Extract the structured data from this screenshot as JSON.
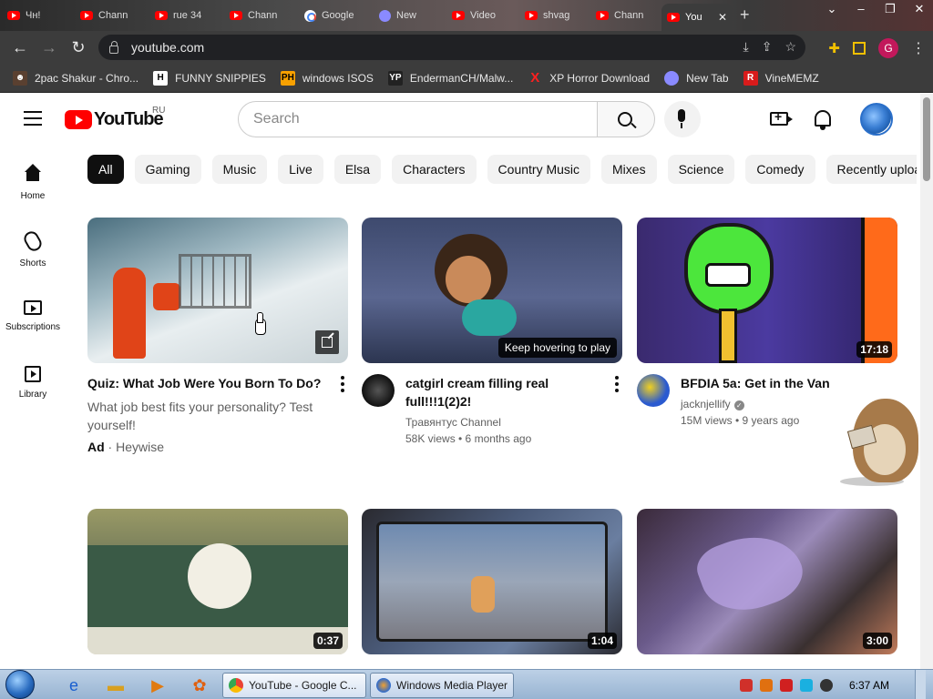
{
  "browser": {
    "tabs": [
      {
        "label": "Чн!"
      },
      {
        "label": "Chann"
      },
      {
        "label": "rue 34"
      },
      {
        "label": "Chann"
      },
      {
        "label": "Google"
      },
      {
        "label": "New"
      },
      {
        "label": "Video"
      },
      {
        "label": "shvag"
      },
      {
        "label": "Chann"
      },
      {
        "label": "You"
      }
    ],
    "address": "youtube.com",
    "profile_letter": "G",
    "bookmarks": [
      {
        "label": "2pac Shakur - Chro...",
        "icon": "tupac-icon"
      },
      {
        "label": "FUNNY SNIPPIES",
        "icon": "h-icon"
      },
      {
        "label": "windows ISOS",
        "icon": "ph-icon"
      },
      {
        "label": "EndermanCH/Malw...",
        "icon": "yp-icon"
      },
      {
        "label": "XP Horror Download",
        "icon": "x-icon"
      },
      {
        "label": "New Tab",
        "icon": "globe-icon"
      },
      {
        "label": "VineMEMZ",
        "icon": "r-icon"
      }
    ]
  },
  "youtube": {
    "logo_text": "YouTube",
    "region": "RU",
    "search_placeholder": "Search",
    "chips": [
      "All",
      "Gaming",
      "Music",
      "Live",
      "Elsa",
      "Characters",
      "Country Music",
      "Mixes",
      "Science",
      "Comedy",
      "Recently uploaded"
    ],
    "rail": [
      {
        "label": "Home",
        "icon": "home-icon"
      },
      {
        "label": "Shorts",
        "icon": "shorts-icon"
      },
      {
        "label": "Subscriptions",
        "icon": "subscriptions-icon"
      },
      {
        "label": "Library",
        "icon": "library-icon"
      }
    ],
    "videos": [
      {
        "title": "Quiz: What Job Were You Born To Do?",
        "description": "What job best fits your personality? Test yourself!",
        "ad_label": "Ad",
        "advertiser": "Heywise"
      },
      {
        "title": "catgirl cream filling real full!!!1(2)2!",
        "channel": "Травянтус Channel",
        "stats": "58K views • 6 months ago",
        "hover_hint": "Keep hovering to play"
      },
      {
        "title": "BFDIA 5a: Get in the Van",
        "channel": "jacknjellify",
        "stats": "15M views • 9 years ago",
        "duration": "17:18"
      },
      {
        "duration": "0:37"
      },
      {
        "duration": "1:04"
      },
      {
        "duration": "3:00"
      }
    ]
  },
  "taskbar": {
    "windows": [
      {
        "label": "YouTube - Google C...",
        "icon": "chrome-icon"
      },
      {
        "label": "Windows Media Player",
        "icon": "media-player-icon"
      }
    ],
    "clock": "6:37 AM"
  },
  "colors": {
    "youtube_red": "#ff0000",
    "chip_active_bg": "#0f0f0f",
    "chip_bg": "#f2f2f2",
    "chrome_dark": "#3c3c3c"
  }
}
